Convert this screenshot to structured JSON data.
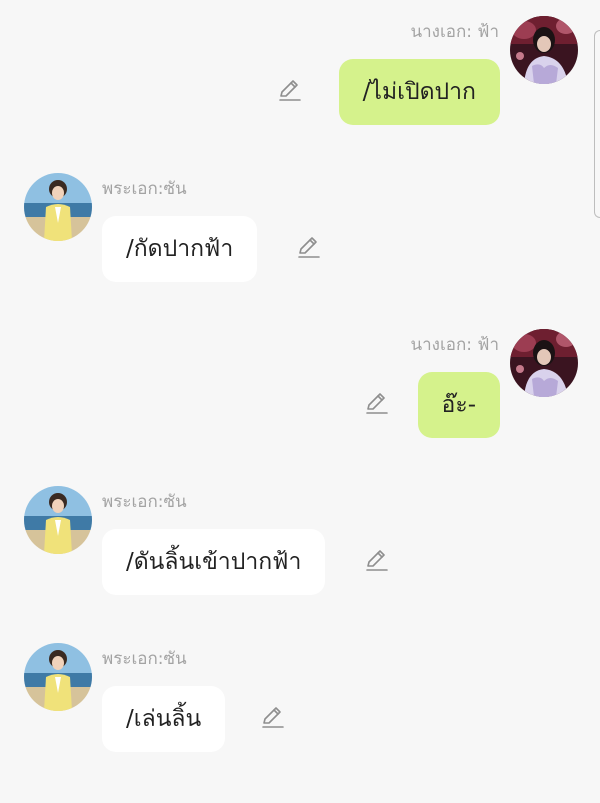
{
  "messages": [
    {
      "side": "right",
      "sender": "นางเอก: ฟ้า",
      "text": "/ไม่เปิดปาก",
      "avatar": "heroine-avatar"
    },
    {
      "side": "left",
      "sender": "พระเอก:ซัน",
      "text": "/กัดปากฟ้า",
      "avatar": "hero-avatar"
    },
    {
      "side": "right",
      "sender": "นางเอก: ฟ้า",
      "text": "อ๊ะ-",
      "avatar": "heroine-avatar"
    },
    {
      "side": "left",
      "sender": "พระเอก:ซัน",
      "text": "/ดันลิ้นเข้าปากฟ้า",
      "avatar": "hero-avatar"
    },
    {
      "side": "left",
      "sender": "พระเอก:ซัน",
      "text": "/เล่นลิ้น",
      "avatar": "hero-avatar"
    }
  ],
  "icons": {
    "edit": "pencil-icon",
    "scroll": "scrollbar-edge"
  },
  "colors": {
    "background": "#f7f7f7",
    "sent_bubble": "#d5f28c",
    "received_bubble": "#ffffff",
    "sender_name": "#a3a3a3",
    "message_text": "#222222"
  }
}
